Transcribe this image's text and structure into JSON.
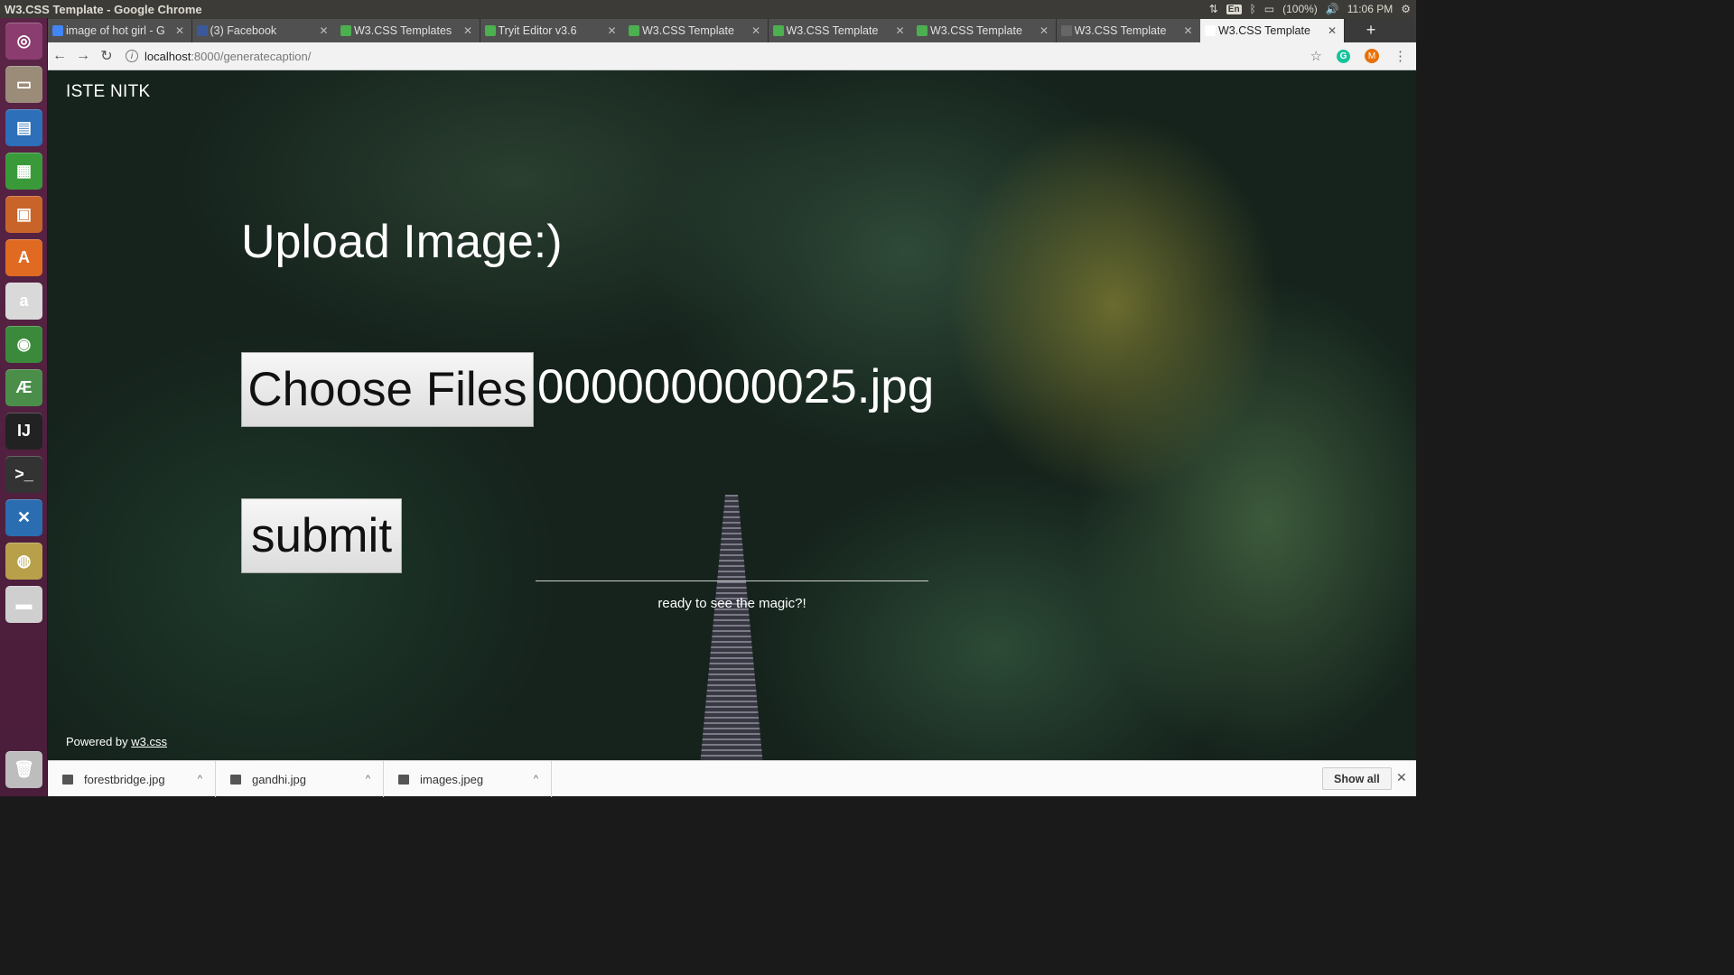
{
  "os": {
    "window_title": "W3.CSS Template - Google Chrome",
    "keyboard": "En",
    "battery": "(100%)",
    "time": "11:06 PM"
  },
  "launcher": {
    "items": [
      {
        "name": "ubuntu-dash-icon",
        "glyph": "◎",
        "color": "#8a3d6e"
      },
      {
        "name": "files-icon",
        "glyph": "▭",
        "color": "#9a8c78"
      },
      {
        "name": "writer-icon",
        "glyph": "▤",
        "color": "#2d6fb8"
      },
      {
        "name": "calc-icon",
        "glyph": "▦",
        "color": "#3a9a3a"
      },
      {
        "name": "impress-icon",
        "glyph": "▣",
        "color": "#c8642a"
      },
      {
        "name": "software-center-icon",
        "glyph": "A",
        "color": "#e06a22"
      },
      {
        "name": "amazon-icon",
        "glyph": "a",
        "color": "#d9d9d9"
      },
      {
        "name": "chrome-icon",
        "glyph": "◉",
        "color": "#3b8a3b"
      },
      {
        "name": "android-studio-icon",
        "glyph": "Æ",
        "color": "#4a8e4a"
      },
      {
        "name": "intellij-icon",
        "glyph": "IJ",
        "color": "#222222"
      },
      {
        "name": "terminal-icon",
        "glyph": ">_",
        "color": "#333333"
      },
      {
        "name": "vscode-icon",
        "glyph": "✕",
        "color": "#2a6db0"
      },
      {
        "name": "image-viewer-icon",
        "glyph": "◍",
        "color": "#b8a04a"
      },
      {
        "name": "drive-icon",
        "glyph": "▬",
        "color": "#cfcfcf"
      },
      {
        "name": "trash-icon",
        "glyph": "🗑",
        "color": "#bdbdbd"
      }
    ]
  },
  "tabs": [
    {
      "label": "image of hot girl - G",
      "fav": "#4285f4"
    },
    {
      "label": "(3) Facebook",
      "fav": "#3b5998"
    },
    {
      "label": "W3.CSS Templates",
      "fav": "#4caf50"
    },
    {
      "label": "Tryit Editor v3.6",
      "fav": "#4caf50"
    },
    {
      "label": "W3.CSS Template",
      "fav": "#4caf50"
    },
    {
      "label": "W3.CSS Template",
      "fav": "#4caf50"
    },
    {
      "label": "W3.CSS Template",
      "fav": "#4caf50"
    },
    {
      "label": "W3.CSS Template",
      "fav": "#666666"
    },
    {
      "label": "W3.CSS Template",
      "fav": "#ffffff",
      "active": true
    }
  ],
  "toolbar": {
    "url_host": "localhost",
    "url_path": ":8000/generatecaption/",
    "profile_initial": "M"
  },
  "page": {
    "brand": "ISTE NITK",
    "heading": "Upload Image:)",
    "choose_files_label": "Choose Files",
    "file_name": "000000000025.jpg",
    "submit_label": "submit",
    "magic_text": "ready to see the magic?!",
    "footer_prefix": "Powered by ",
    "footer_link": "w3.css"
  },
  "downloads": {
    "items": [
      "forestbridge.jpg",
      "gandhi.jpg",
      "images.jpeg"
    ],
    "show_all": "Show all"
  }
}
